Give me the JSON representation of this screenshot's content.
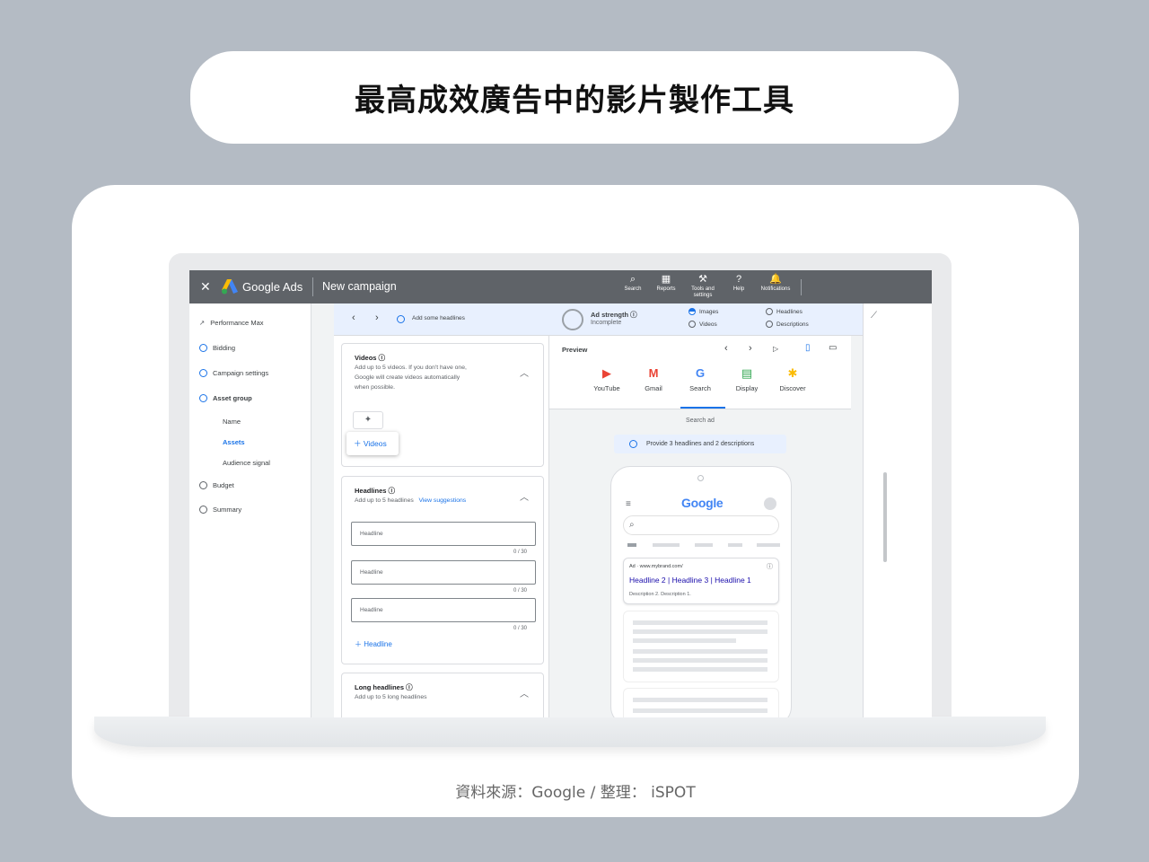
{
  "page": {
    "title": "最高成效廣告中的影片製作工具",
    "source": "資料來源：Google / 整理： iSPOT"
  },
  "topbar": {
    "close": "✕",
    "brand": "Google Ads",
    "campaign": "New campaign",
    "icons": [
      {
        "label1": "Search",
        "label2": "",
        "glyph": "⌕"
      },
      {
        "label1": "Reports",
        "label2": "",
        "glyph": "▦"
      },
      {
        "label1": "Tools and",
        "label2": "settings",
        "glyph": "⚒"
      },
      {
        "label1": "Help",
        "label2": "",
        "glyph": "?"
      },
      {
        "label1": "Notifications",
        "label2": "",
        "glyph": "🔔"
      }
    ]
  },
  "sidebar": {
    "header": "Performance Max",
    "items": [
      {
        "label": "Bidding",
        "state": "done"
      },
      {
        "label": "Campaign settings",
        "state": "done"
      },
      {
        "label": "Asset group",
        "state": "current"
      },
      {
        "label": "Budget",
        "state": "todo"
      },
      {
        "label": "Summary",
        "state": "todo"
      }
    ],
    "subitems": [
      "Name",
      "Assets",
      "Audience signal"
    ]
  },
  "stepbar": {
    "hint": "Add some headlines",
    "strength_title": "Ad strength ⓘ",
    "strength_value": "Incomplete",
    "checks": [
      "Images",
      "Videos",
      "Headlines",
      "Descriptions"
    ]
  },
  "videos": {
    "title": "Videos ⓘ",
    "desc1": "Add up to 5 videos. If you don't have one,",
    "desc2": "Google will create videos automatically",
    "desc3": "when possible.",
    "add": "Videos"
  },
  "headlines": {
    "title": "Headlines ⓘ",
    "desc": "Add up to 5 headlines",
    "suggest": "View suggestions",
    "placeholder": "Headline",
    "count": "0 / 30",
    "add": "Headline"
  },
  "long_headlines": {
    "title": "Long headlines ⓘ",
    "desc": "Add up to 5 long headlines"
  },
  "preview": {
    "title": "Preview",
    "channels": [
      {
        "label": "YouTube",
        "glyph": "▶",
        "color": "#ea4335"
      },
      {
        "label": "Gmail",
        "glyph": "M",
        "color": "#ea4335"
      },
      {
        "label": "Search",
        "glyph": "G",
        "color": "#4285f4"
      },
      {
        "label": "Display",
        "glyph": "▤",
        "color": "#34a853"
      },
      {
        "label": "Discover",
        "glyph": "✱",
        "color": "#fbbc04"
      }
    ],
    "search_ad": "Search ad",
    "notice": "Provide 3 headlines and 2 descriptions",
    "google": "Google",
    "ad_url": "Ad · www.mybrand.com/",
    "ad_headline": "Headline 2 | Headline 3 | Headline 1",
    "ad_desc": "Description 2. Description 1."
  },
  "colors": {
    "accent": "#1a73e8",
    "topbar": "#5f6368",
    "background": "#b4bbc4"
  }
}
